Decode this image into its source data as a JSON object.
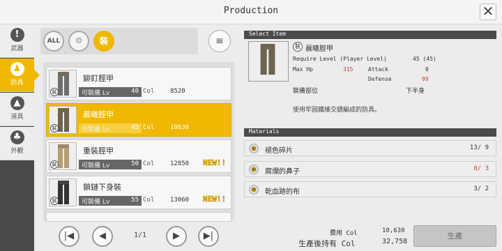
{
  "header": {
    "title": "Production",
    "close_icon": "✕"
  },
  "sidebar": {
    "items": [
      {
        "label": "武器",
        "icon": "!"
      },
      {
        "label": "防具",
        "icon": "♟"
      },
      {
        "label": "道具",
        "icon": "▲"
      },
      {
        "label": "外觀",
        "icon": "♣"
      }
    ]
  },
  "filters": {
    "all_label": "ALL",
    "armor_icon": "☹",
    "equip_icon": "裝",
    "sort_icon": "≡"
  },
  "items": [
    {
      "name": "鉚釘脛甲",
      "lv_label": "可裝備 Lv",
      "lv": "40",
      "col_label": "Col",
      "col": "8520",
      "new": ""
    },
    {
      "name": "晨曦脛甲",
      "lv_label": "可裝備 Lv",
      "lv": "45",
      "col_label": "Col",
      "col": "10630",
      "new": ""
    },
    {
      "name": "重裝脛甲",
      "lv_label": "可裝備 Lv",
      "lv": "50",
      "col_label": "Col",
      "col": "12850",
      "new": "NEW!!"
    },
    {
      "name": "鎖鏈下身裝",
      "lv_label": "可裝備 Lv",
      "lv": "55",
      "col_label": "Col",
      "col": "13060",
      "new": "NEW!!"
    },
    {
      "name": "",
      "lv_label": "",
      "lv": "",
      "col_label": "",
      "col": "",
      "new": ""
    }
  ],
  "pager": {
    "first_icon": "|◀",
    "prev_icon": "◀",
    "next_icon": "▶",
    "last_icon": "▶|",
    "page_text": "1/1"
  },
  "select_item": {
    "header": "Select Item",
    "name": "晨曦脛甲",
    "require_label": "Require Level (Player Level)",
    "require_value": "45 (45)",
    "maxhp_label": "Max Hp",
    "maxhp_value": "315",
    "attack_label": "Attack",
    "attack_value": "0",
    "defense_label": "Defense",
    "defense_value": "99",
    "slot_label": "裝備部位",
    "slot_value": "下半身",
    "description": "使用牢固鐵維交錯編成的防具。"
  },
  "materials": {
    "header": "Materials",
    "items": [
      {
        "name": "褪色碎片",
        "qty": "13/ 9",
        "insufficient": false
      },
      {
        "name": "腐爛的鼻子",
        "qty": "0/ 3",
        "insufficient": true
      },
      {
        "name": "乾血跡的布",
        "qty": "3/ 2",
        "insufficient": false
      }
    ]
  },
  "cost": {
    "cost_label": "費用 Col",
    "cost_value": "10,630",
    "remain_label": "生產後持有 Col",
    "remain_value": "32,758",
    "produce_label": "生產"
  },
  "colors": {
    "accent": "#f0b800",
    "dark": "#4a4a4a",
    "warn": "#d63a3a"
  }
}
